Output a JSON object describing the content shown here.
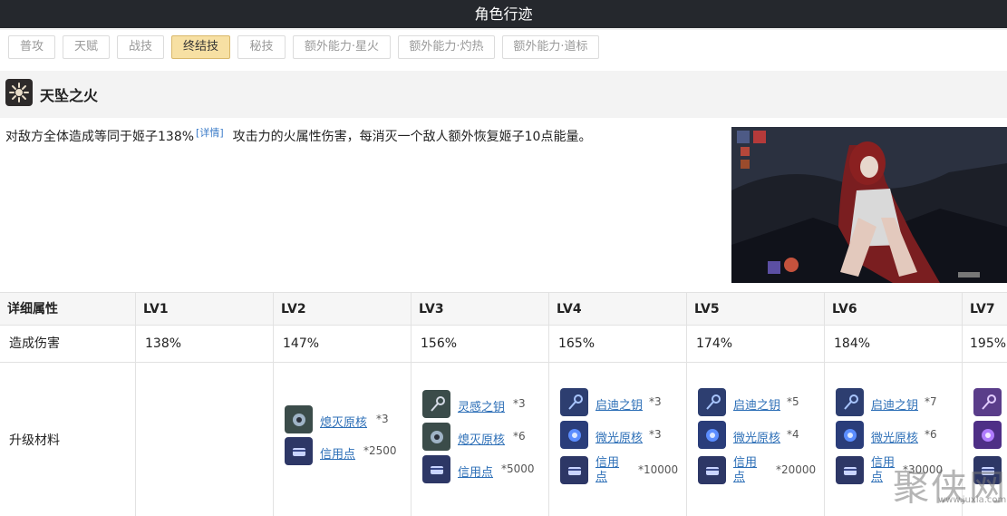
{
  "header": {
    "title": "角色行迹"
  },
  "tabs": [
    {
      "label": "普攻"
    },
    {
      "label": "天赋"
    },
    {
      "label": "战技"
    },
    {
      "label": "终结技",
      "active": true
    },
    {
      "label": "秘技"
    },
    {
      "label": "额外能力·星火"
    },
    {
      "label": "额外能力·灼热"
    },
    {
      "label": "额外能力·道标"
    }
  ],
  "skill": {
    "name": "天坠之火",
    "desc_before": "对敌方全体造成等同于姬子138%",
    "detail_link": "[详情]",
    "desc_after": "攻击力的火属性伤害，每消灭一个敌人额外恢复姬子10点能量。"
  },
  "table": {
    "headers": [
      "详细属性",
      "LV1",
      "LV2",
      "LV3",
      "LV4",
      "LV5",
      "LV6",
      "LV7"
    ],
    "damage_label": "造成伤害",
    "damage": [
      "138%",
      "147%",
      "156%",
      "165%",
      "174%",
      "184%",
      "195%"
    ],
    "materials_label": "升级材料",
    "materials": [
      [],
      [
        {
          "name": "熄灭原核",
          "qty": "*3"
        },
        {
          "name": "信用点",
          "qty": "*2500"
        }
      ],
      [
        {
          "name": "灵感之钥",
          "qty": "*3"
        },
        {
          "name": "熄灭原核",
          "qty": "*6"
        },
        {
          "name": "信用点",
          "qty": "*5000"
        }
      ],
      [
        {
          "name": "启迪之钥",
          "qty": "*3"
        },
        {
          "name": "微光原核",
          "qty": "*3"
        },
        {
          "name": "信用点",
          "qty": "*10000"
        }
      ],
      [
        {
          "name": "启迪之钥",
          "qty": "*5"
        },
        {
          "name": "微光原核",
          "qty": "*4"
        },
        {
          "name": "信用点",
          "qty": "*20000"
        }
      ],
      [
        {
          "name": "启迪之钥",
          "qty": "*7"
        },
        {
          "name": "微光原核",
          "qty": "*6"
        },
        {
          "name": "信用点",
          "qty": "*30000"
        }
      ],
      []
    ]
  },
  "watermark": {
    "text": "聚侠网",
    "url": "www.juxia.com"
  },
  "colors": {
    "titlebar": "#25282d",
    "active_tab": "#f7e0a3",
    "link": "#2d6fb7"
  }
}
